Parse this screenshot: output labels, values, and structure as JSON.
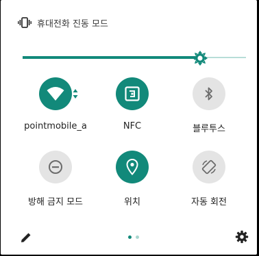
{
  "status": {
    "vibrate_icon": "vibrate-icon",
    "label": "휴대전화 진동 모드"
  },
  "brightness": {
    "level": 0.795,
    "fill_color": "#12897a",
    "track_color": "#b7ddd7"
  },
  "tiles": [
    {
      "label": "pointmobile_a",
      "icon": "wifi-icon",
      "active": true
    },
    {
      "label": "NFC",
      "icon": "nfc-icon",
      "active": true
    },
    {
      "label": "블루투스",
      "icon": "bluetooth-icon",
      "active": false
    },
    {
      "label": "방해 금지 모드",
      "icon": "do-not-disturb-icon",
      "active": false
    },
    {
      "label": "위치",
      "icon": "location-icon",
      "active": true
    },
    {
      "label": "자동 회전",
      "icon": "auto-rotate-icon",
      "active": false
    }
  ],
  "pager": {
    "pages": 2,
    "current": 1
  },
  "colors": {
    "accent": "#12897a",
    "inactive": "#e4e4e4"
  }
}
